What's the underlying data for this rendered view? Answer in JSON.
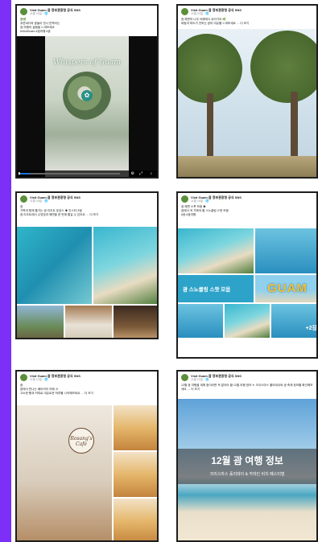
{
  "page": {
    "background_accent": "#7b2ff7"
  },
  "posts": [
    {
      "page_name": "Visit Guam 괌 정부관광청 공식 SNS",
      "time": "11월 23일 · 🌐",
      "lines": [
        "괌🌿",
        "푸른바다와 꽃들이 만나 반짝이는",
        "괌 여행의 설렘을 느껴보세요",
        "#VisitGuam #괌여행 #괌"
      ],
      "video_title": "Whispers of Guam",
      "video_progress": 0.1
    },
    {
      "page_name": "Visit Guam 괌 정부관광청 공식 SNS",
      "time": "11월 20일 · 🌐",
      "lines": [
        "괌 해변의 나무 아래에서 쉬어가요 🌿",
        "바람과 파도가 전하는 괌의 여유를 느껴보세요 … 더 보기"
      ]
    },
    {
      "page_name": "Visit Guam 괌 정부관광청 공식 SNS",
      "time": "11월 18일 · 🌐",
      "lines": [
        "괌",
        "가족과 함께 즐기는 괌 리조트 호캉스 ☀ 인스타그램",
        "괌 리조트에서 수영장과 해변을 한 번에 즐길 수 있어요 … 더 보기"
      ],
      "link": "인스타그램"
    },
    {
      "page_name": "Visit Guam 괌 정부관광청 공식 SNS",
      "time": "11월 15일 · 🌐",
      "lines": [
        "괌 해변 스폿 모음 ☀",
        "괌에서 꼭 가봐야 할 스노클링 스팟 모음",
        "#괌 #괌여행"
      ],
      "collage_label": "괌 스노클링 스팟 모음",
      "guam_sign": "GUAM",
      "more_count": "+2장"
    },
    {
      "page_name": "Visit Guam 괌 정부관광청 공식 SNS",
      "time": "11월 12일 · 🌐",
      "lines": [
        "괌",
        "괌에서 만나는 베이커리 카페 ☕",
        "고소한 빵과 커피로 여유로운 하루를 시작해보세요 … 더 보기"
      ],
      "cafe_sign": "Rosang's Cafe"
    },
    {
      "page_name": "Visit Guam 괌 정부관광청 공식 SNS",
      "time": "11월 10일 · 🌐",
      "lines": [
        "12월 괌 여행을 계획 중이라면 꼭 알아야 할 12월 여행 정보 ✈ 크리스마스 홀리데이와 괌 축제 정보를 확인해보세요 … 더 보기"
      ],
      "title": "12월 괌 여행 정보",
      "subtitle": "크리스마스 홀리데이 & 카마킨 비치 페스티벌"
    }
  ]
}
